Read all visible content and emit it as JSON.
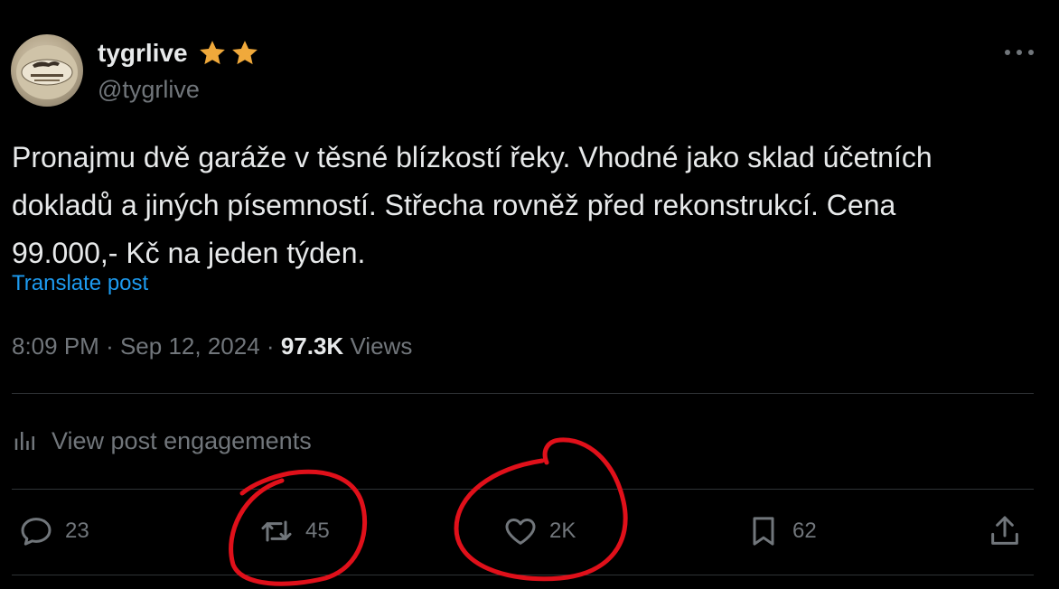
{
  "author": {
    "display_name": "tygrlive",
    "handle": "@tygrlive",
    "avatar_icon": "tiger-logo-avatar",
    "badges": [
      "star-icon",
      "star-icon"
    ],
    "badge_color": "#f0a93b"
  },
  "post": {
    "text_lines": [
      "Pronajmu dvě garáže v těsné blízkostí řeky. Vhodné jako sklad účetních",
      "dokladů a jiných písemností. Střecha rovněž před rekonstrukcí. Cena",
      "99.000,- Kč na jeden týden."
    ],
    "translate_label": "Translate post"
  },
  "meta": {
    "time": "8:09 PM",
    "separator": "·",
    "date": "Sep 12, 2024",
    "views_count": "97.3K",
    "views_label": "Views"
  },
  "engagements_label": "View post engagements",
  "actions": {
    "reply_count": "23",
    "repost_count": "45",
    "like_count": "2K",
    "bookmark_count": "62"
  },
  "colors": {
    "background": "#000000",
    "text_primary": "#e7e9ea",
    "text_secondary": "#71767b",
    "link": "#1d9bf0",
    "divider": "#2f3336",
    "annotation": "#e0101a"
  }
}
